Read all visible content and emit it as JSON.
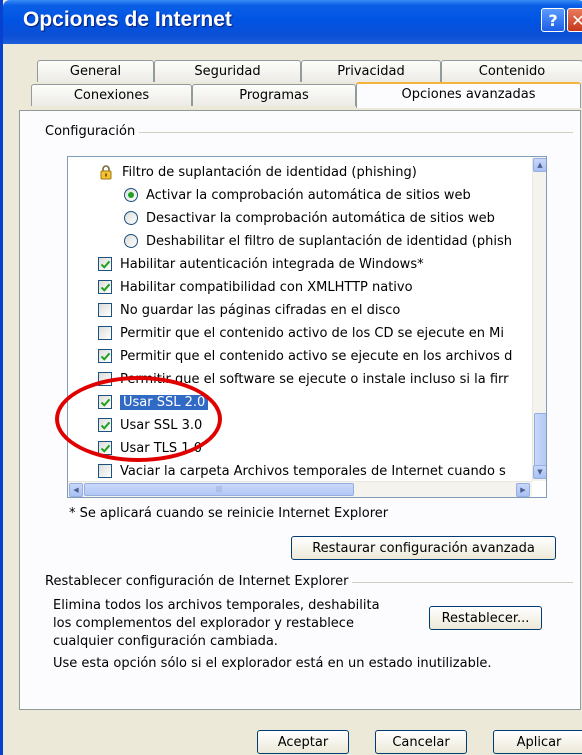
{
  "window": {
    "title": "Opciones de Internet",
    "help_label": "?",
    "close_label": "✕"
  },
  "tabs_row1": [
    "General",
    "Seguridad",
    "Privacidad",
    "Contenido"
  ],
  "tabs_row2": [
    "Conexiones",
    "Programas",
    "Opciones avanzadas"
  ],
  "settings": {
    "group_label": "Configuración",
    "items": [
      {
        "kind": "category",
        "icon": "lock-icon",
        "label": "Filtro de suplantación de identidad (phishing)"
      },
      {
        "kind": "radio",
        "checked": true,
        "label": "Activar la comprobación automática de sitios web"
      },
      {
        "kind": "radio",
        "checked": false,
        "label": "Desactivar la comprobación automática de sitios web"
      },
      {
        "kind": "radio",
        "checked": false,
        "label": "Deshabilitar el filtro de suplantación de identidad (phish"
      },
      {
        "kind": "checkbox",
        "checked": true,
        "label": "Habilitar autenticación integrada de Windows*"
      },
      {
        "kind": "checkbox",
        "checked": true,
        "label": "Habilitar compatibilidad con XMLHTTP nativo"
      },
      {
        "kind": "checkbox",
        "checked": false,
        "label": "No guardar las páginas cifradas en el disco"
      },
      {
        "kind": "checkbox",
        "checked": false,
        "label": "Permitir que el contenido activo de los CD se ejecute en Mi"
      },
      {
        "kind": "checkbox",
        "checked": true,
        "label": "Permitir que el contenido activo se ejecute en los archivos d"
      },
      {
        "kind": "checkbox",
        "checked": false,
        "label": "Permitir que el software se ejecute o instale incluso si la firr"
      },
      {
        "kind": "checkbox",
        "checked": true,
        "label": "Usar SSL 2.0",
        "selected": true
      },
      {
        "kind": "checkbox",
        "checked": true,
        "label": "Usar SSL 3.0"
      },
      {
        "kind": "checkbox",
        "checked": true,
        "label": "Usar TLS 1.0"
      },
      {
        "kind": "checkbox",
        "checked": false,
        "label": "Vaciar la carpeta Archivos temporales de Internet cuando s"
      }
    ],
    "restart_note": "* Se aplicará cuando se reinicie Internet Explorer",
    "restore_button": "Restaurar configuración avanzada"
  },
  "reset": {
    "group_label": "Restablecer configuración de Internet Explorer",
    "description": [
      "Elimina todos los archivos temporales, deshabilita",
      "los complementos del explorador y restablece",
      "cualquier configuración cambiada."
    ],
    "reset_button": "Restablecer...",
    "note": "Use esta opción sólo si el explorador está en un estado inutilizable."
  },
  "footer": {
    "ok": "Aceptar",
    "cancel": "Cancelar",
    "apply": "Aplicar"
  },
  "annotation": {
    "color": "#e00000"
  }
}
